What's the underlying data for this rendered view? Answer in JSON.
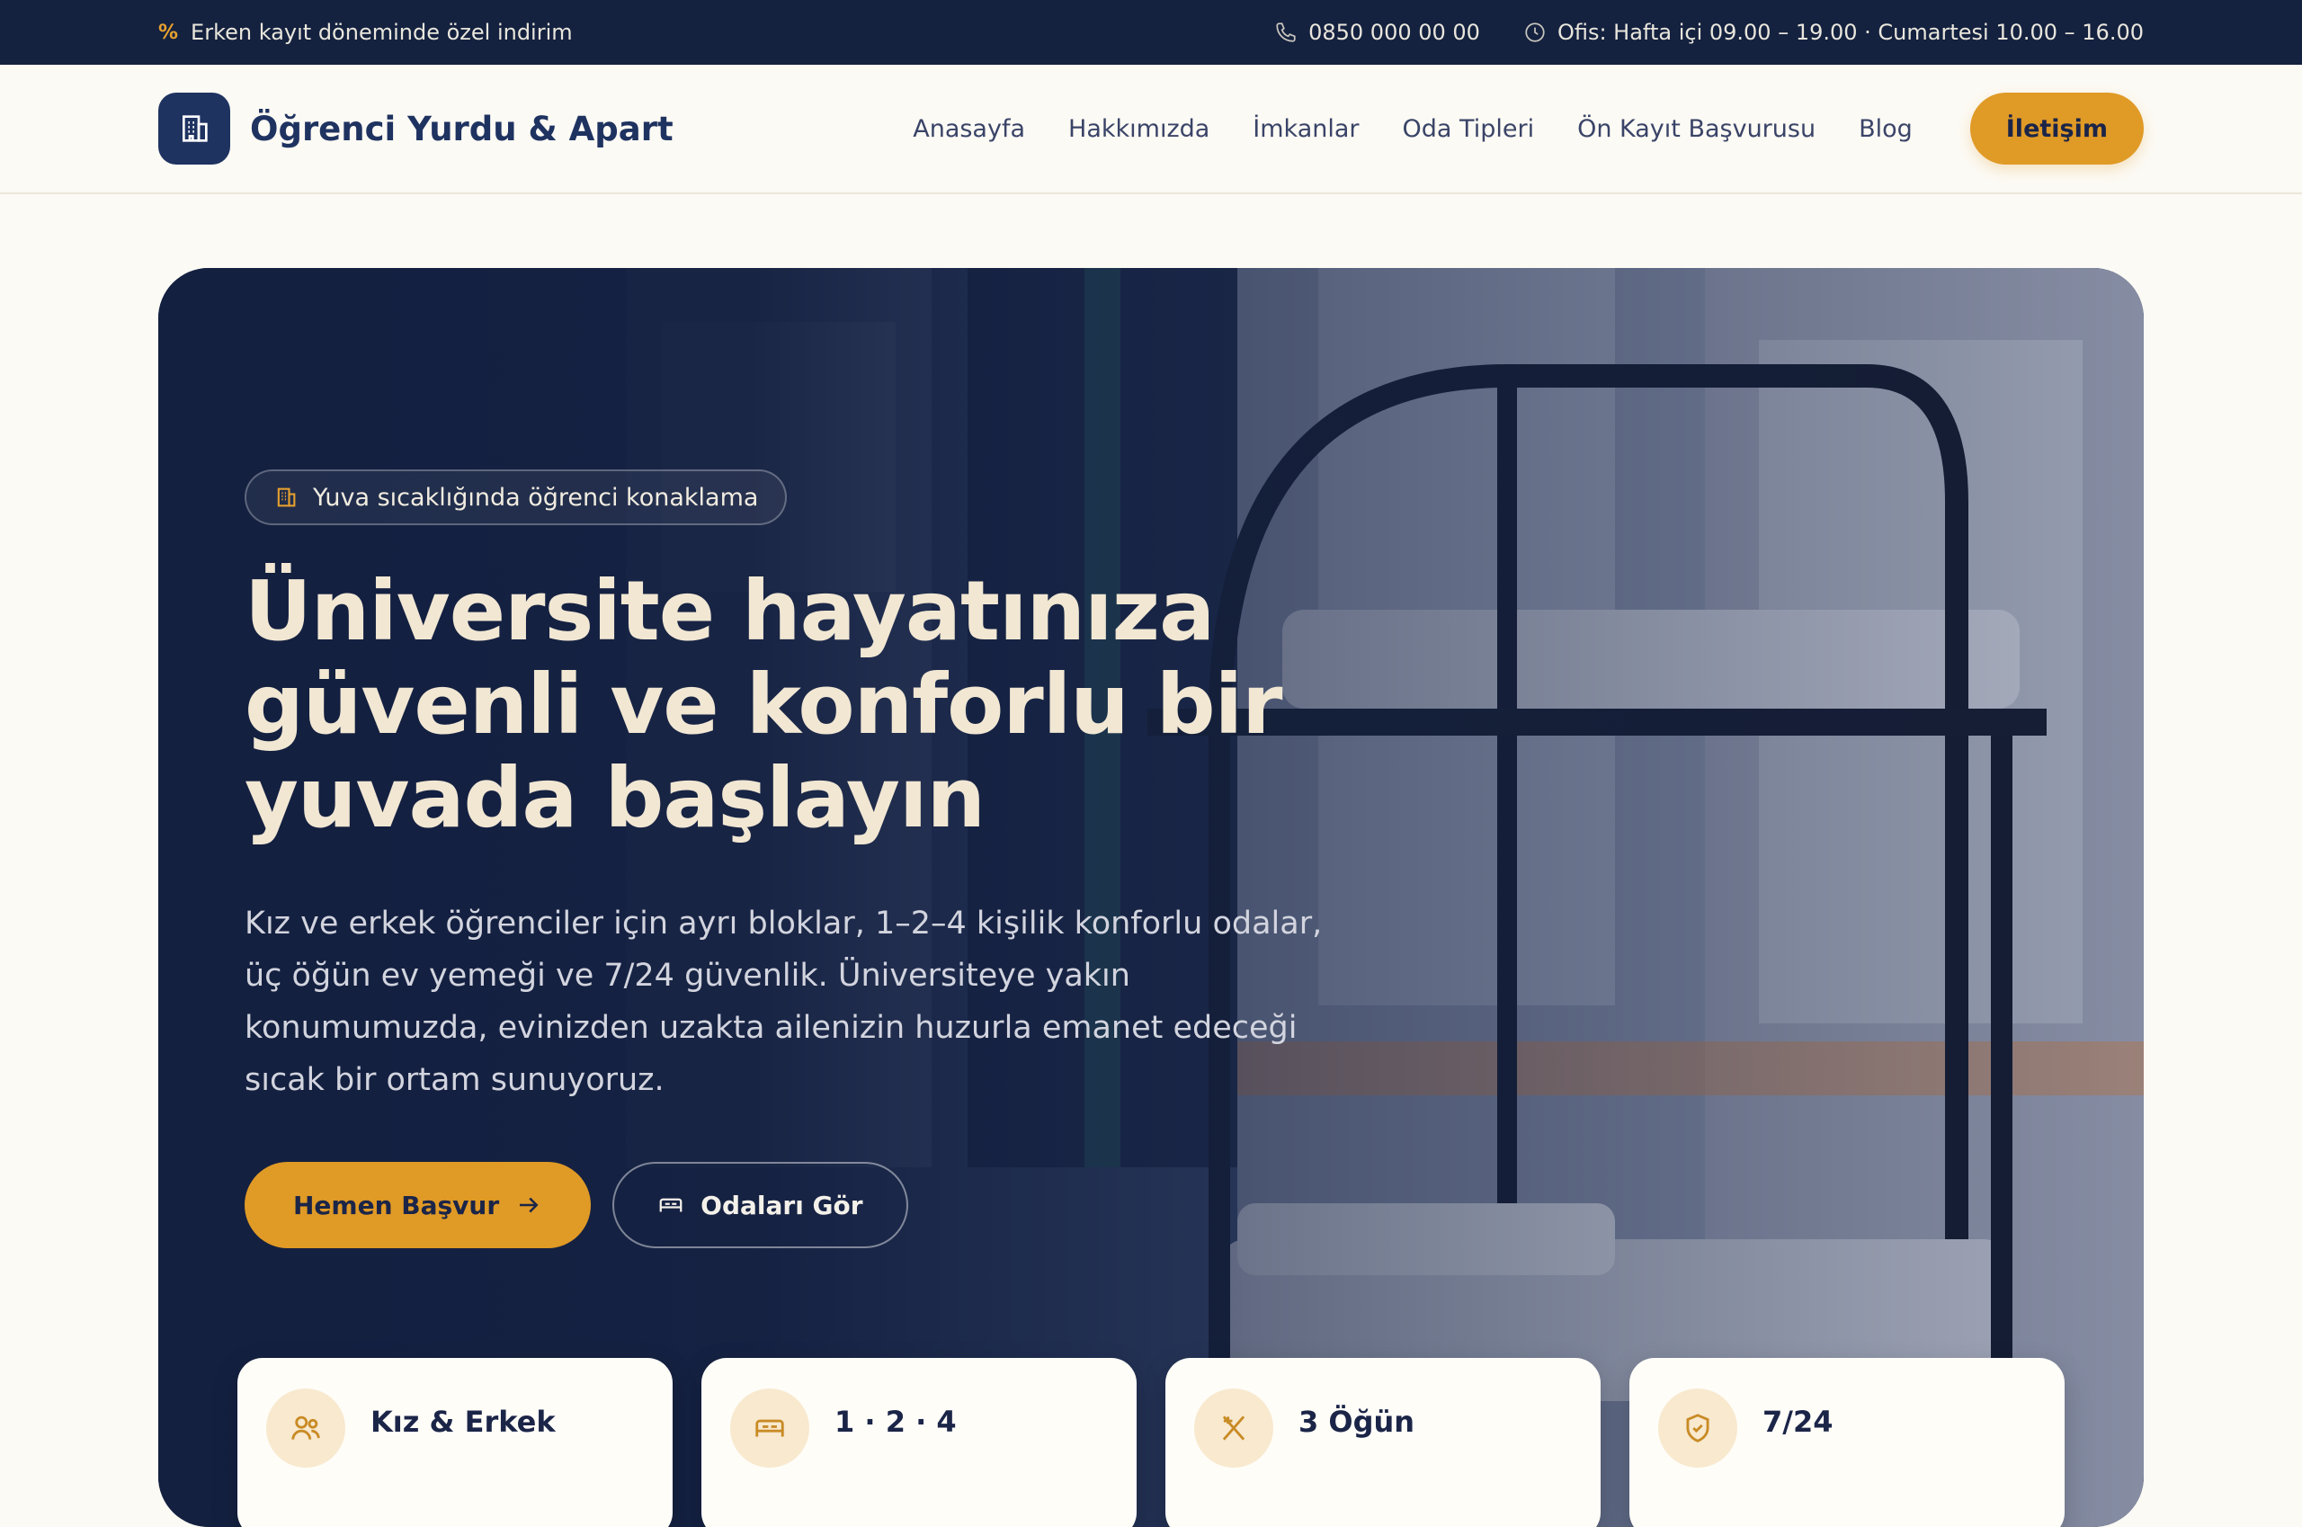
{
  "topbar": {
    "promo_text": "Erken kayıt döneminde özel indirim",
    "phone": "0850 000 00 00",
    "hours": "Ofis: Hafta içi 09.00 – 19.00 · Cumartesi 10.00 – 16.00"
  },
  "brand": {
    "name": "Öğrenci Yurdu & Apart"
  },
  "nav": {
    "items": [
      "Anasayfa",
      "Hakkımızda",
      "İmkanlar",
      "Oda Tipleri",
      "Ön Kayıt Başvurusu",
      "Blog"
    ],
    "contact_label": "İletişim"
  },
  "hero": {
    "badge": "Yuva sıcaklığında öğrenci konaklama",
    "title_lines": [
      "Üniversite hayatınıza",
      "güvenli ve konforlu bir",
      "yuvada başlayın"
    ],
    "description": "Kız ve erkek öğrenciler için ayrı bloklar, 1–2–4 kişilik konforlu odalar, üç öğün ev yemeği ve 7/24 güvenlik. Üniversiteye yakın konumumuzda, evinizden uzakta ailenizin huzurla emanet edeceği sıcak bir ortam sunuyoruz.",
    "primary_cta": "Hemen Başvur",
    "secondary_cta": "Odaları Gör"
  },
  "stats": [
    {
      "title": "Kız & Erkek",
      "icon": "users-icon"
    },
    {
      "title": "1 · 2 · 4",
      "icon": "bed-icon"
    },
    {
      "title": "3 Öğün",
      "icon": "utensils-icon"
    },
    {
      "title": "7/24",
      "icon": "shield-check-icon"
    }
  ],
  "colors": {
    "navy": "#14213f",
    "accent": "#e09a26",
    "background": "#fcfaf4"
  }
}
